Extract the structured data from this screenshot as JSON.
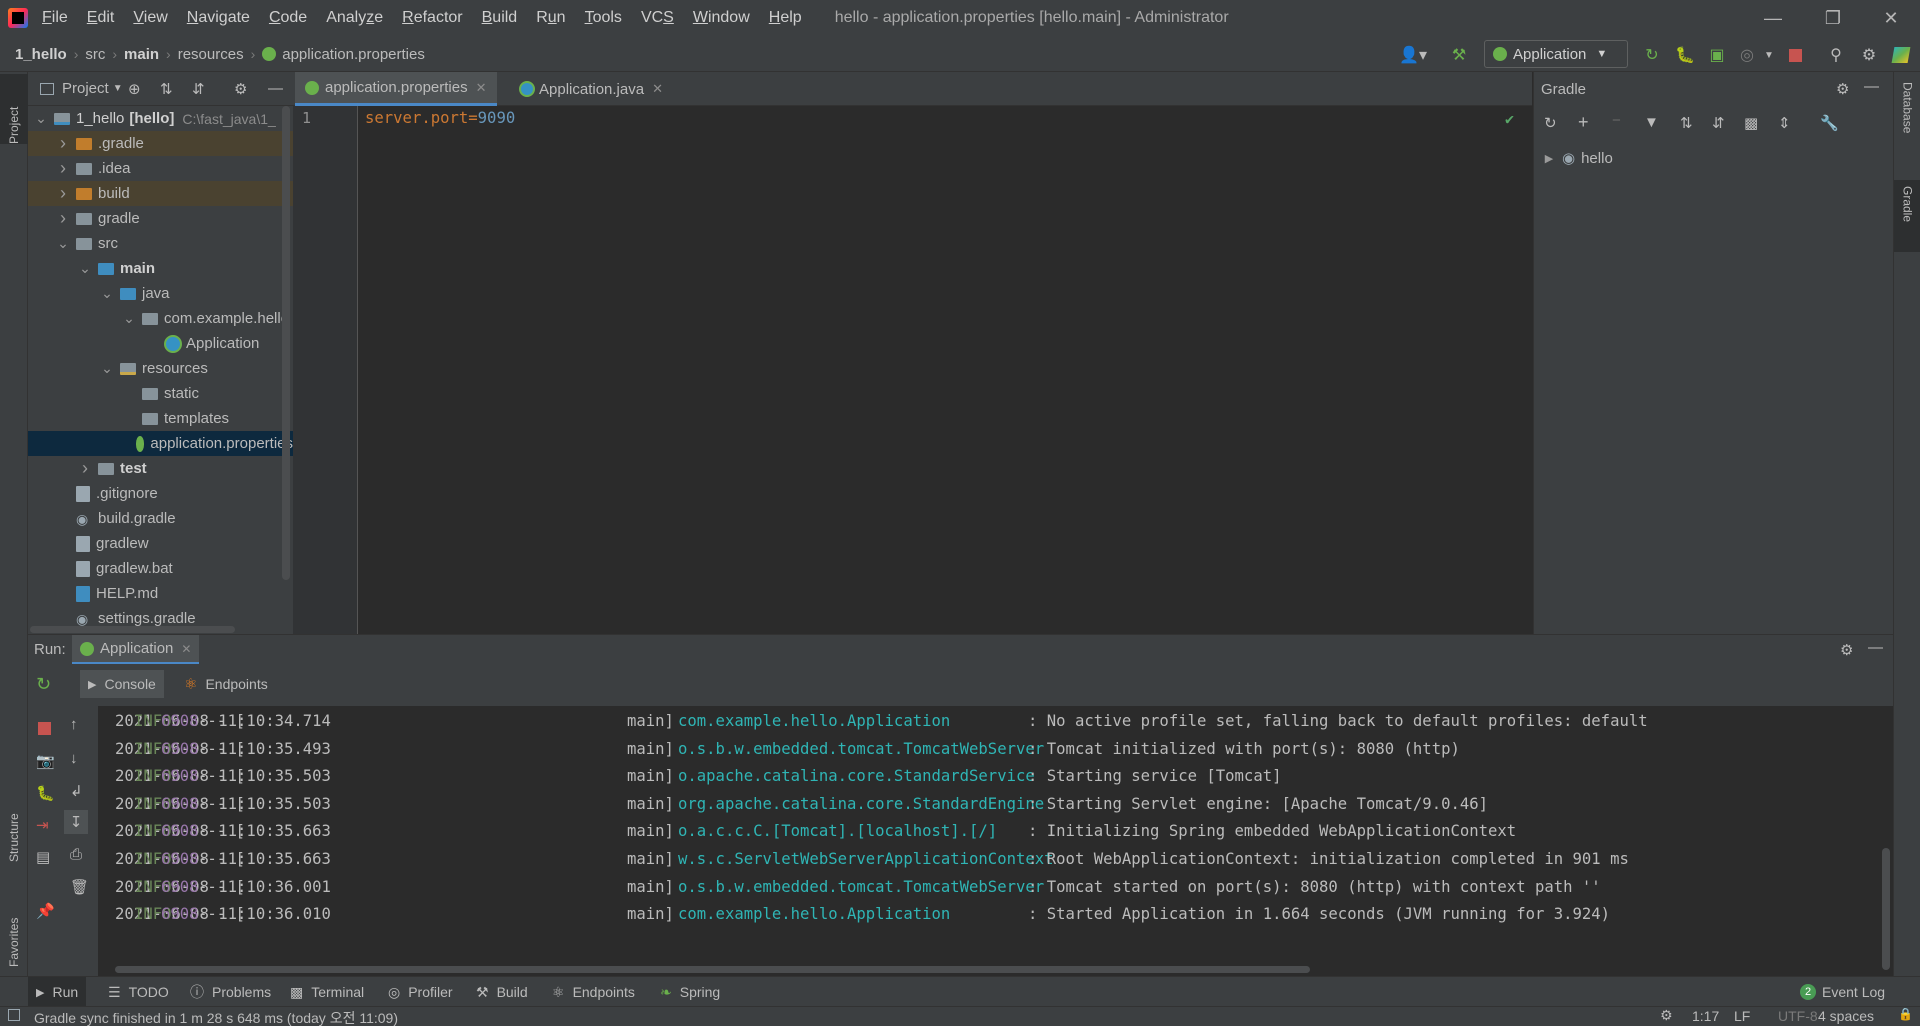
{
  "title_bar": {
    "menus": [
      "File",
      "Edit",
      "View",
      "Navigate",
      "Code",
      "Analyze",
      "Refactor",
      "Build",
      "Run",
      "Tools",
      "VCS",
      "Window",
      "Help"
    ],
    "menu_mnemonics": [
      "F",
      "E",
      "V",
      "N",
      "C",
      "z",
      "R",
      "B",
      "u",
      "T",
      "S",
      "W",
      "H"
    ],
    "window_title": "hello - application.properties [hello.main] - Administrator"
  },
  "breadcrumb": [
    "1_hello",
    "src",
    "main",
    "resources",
    "application.properties"
  ],
  "run_config": {
    "label": "Application"
  },
  "project_panel": {
    "title": "Project",
    "tree": [
      {
        "label": "1_hello",
        "extra": "[hello]",
        "path": "C:\\fast_java\\1_",
        "level": 0,
        "expanded": true
      },
      {
        "label": ".gradle",
        "level": 1,
        "expanded": false
      },
      {
        "label": ".idea",
        "level": 1,
        "expanded": false
      },
      {
        "label": "build",
        "level": 1,
        "expanded": false
      },
      {
        "label": "gradle",
        "level": 1,
        "expanded": false
      },
      {
        "label": "src",
        "level": 1,
        "expanded": true
      },
      {
        "label": "main",
        "level": 2,
        "expanded": true
      },
      {
        "label": "java",
        "level": 3,
        "expanded": true
      },
      {
        "label": "com.example.hello",
        "level": 4,
        "expanded": true
      },
      {
        "label": "Application",
        "level": 5
      },
      {
        "label": "resources",
        "level": 3,
        "expanded": true
      },
      {
        "label": "static",
        "level": 4
      },
      {
        "label": "templates",
        "level": 4
      },
      {
        "label": "application.properties",
        "level": 4
      },
      {
        "label": "test",
        "level": 2,
        "expanded": false
      },
      {
        "label": ".gitignore",
        "level": 1
      },
      {
        "label": "build.gradle",
        "level": 1
      },
      {
        "label": "gradlew",
        "level": 1
      },
      {
        "label": "gradlew.bat",
        "level": 1
      },
      {
        "label": "HELP.md",
        "level": 1
      },
      {
        "label": "settings.gradle",
        "level": 1
      }
    ]
  },
  "editor": {
    "tabs": [
      {
        "label": "application.properties",
        "active": true
      },
      {
        "label": "Application.java",
        "active": false
      }
    ],
    "line_number": "1",
    "code": {
      "key": "server.port",
      "eq": "=",
      "value": "9090"
    }
  },
  "gradle_panel": {
    "title": "Gradle",
    "root_item": "hello"
  },
  "side_tabs": {
    "left_top": "Project",
    "left_structure": "Structure",
    "left_favorites": "Favorites",
    "right_database": "Database",
    "right_gradle": "Gradle"
  },
  "run_panel": {
    "label": "Run:",
    "tab": "Application",
    "subtabs": [
      "Console",
      "Endpoints"
    ],
    "log_lines": [
      {
        "ts": "2021-06-08 11:10:34.714",
        "level": "INFO",
        "pid": "6908",
        "thread": "main",
        "logger": "com.example.hello.Application",
        "msg": ": No active profile set, falling back to default profiles: default"
      },
      {
        "ts": "2021-06-08 11:10:35.493",
        "level": "INFO",
        "pid": "6908",
        "thread": "main",
        "logger": "o.s.b.w.embedded.tomcat.TomcatWebServer",
        "msg": ": Tomcat initialized with port(s): 8080 (http)"
      },
      {
        "ts": "2021-06-08 11:10:35.503",
        "level": "INFO",
        "pid": "6908",
        "thread": "main",
        "logger": "o.apache.catalina.core.StandardService",
        "msg": ": Starting service [Tomcat]"
      },
      {
        "ts": "2021-06-08 11:10:35.503",
        "level": "INFO",
        "pid": "6908",
        "thread": "main",
        "logger": "org.apache.catalina.core.StandardEngine",
        "msg": ": Starting Servlet engine: [Apache Tomcat/9.0.46]"
      },
      {
        "ts": "2021-06-08 11:10:35.663",
        "level": "INFO",
        "pid": "6908",
        "thread": "main",
        "logger": "o.a.c.c.C.[Tomcat].[localhost].[/]",
        "msg": ": Initializing Spring embedded WebApplicationContext"
      },
      {
        "ts": "2021-06-08 11:10:35.663",
        "level": "INFO",
        "pid": "6908",
        "thread": "main",
        "logger": "w.s.c.ServletWebServerApplicationContext",
        "msg": ": Root WebApplicationContext: initialization completed in 901 ms"
      },
      {
        "ts": "2021-06-08 11:10:36.001",
        "level": "INFO",
        "pid": "6908",
        "thread": "main",
        "logger": "o.s.b.w.embedded.tomcat.TomcatWebServer",
        "msg": ": Tomcat started on port(s): 8080 (http) with context path ''"
      },
      {
        "ts": "2021-06-08 11:10:36.010",
        "level": "INFO",
        "pid": "6908",
        "thread": "main",
        "logger": "com.example.hello.Application",
        "msg": ": Started Application in 1.664 seconds (JVM running for 3.924)"
      }
    ]
  },
  "bottom_tabs": [
    "Run",
    "TODO",
    "Problems",
    "Terminal",
    "Profiler",
    "Build",
    "Endpoints",
    "Spring"
  ],
  "event_log": {
    "count": "2",
    "label": "Event Log"
  },
  "status_bar": {
    "message": "Gradle sync finished in 1 m 28 s 648 ms (today 오전 11:09)",
    "position": "1:17",
    "line_sep": "LF",
    "encoding": "UTF-8",
    "indent": "4 spaces"
  },
  "colors": {
    "accent": "#4a88c7",
    "spring_green": "#6ab04c",
    "stop_red": "#c75450",
    "log_level": "#6a8759",
    "log_pid": "#9876aa",
    "log_logger": "#2fb5b5",
    "prop_key": "#cc7832",
    "prop_value": "#6897bb"
  }
}
